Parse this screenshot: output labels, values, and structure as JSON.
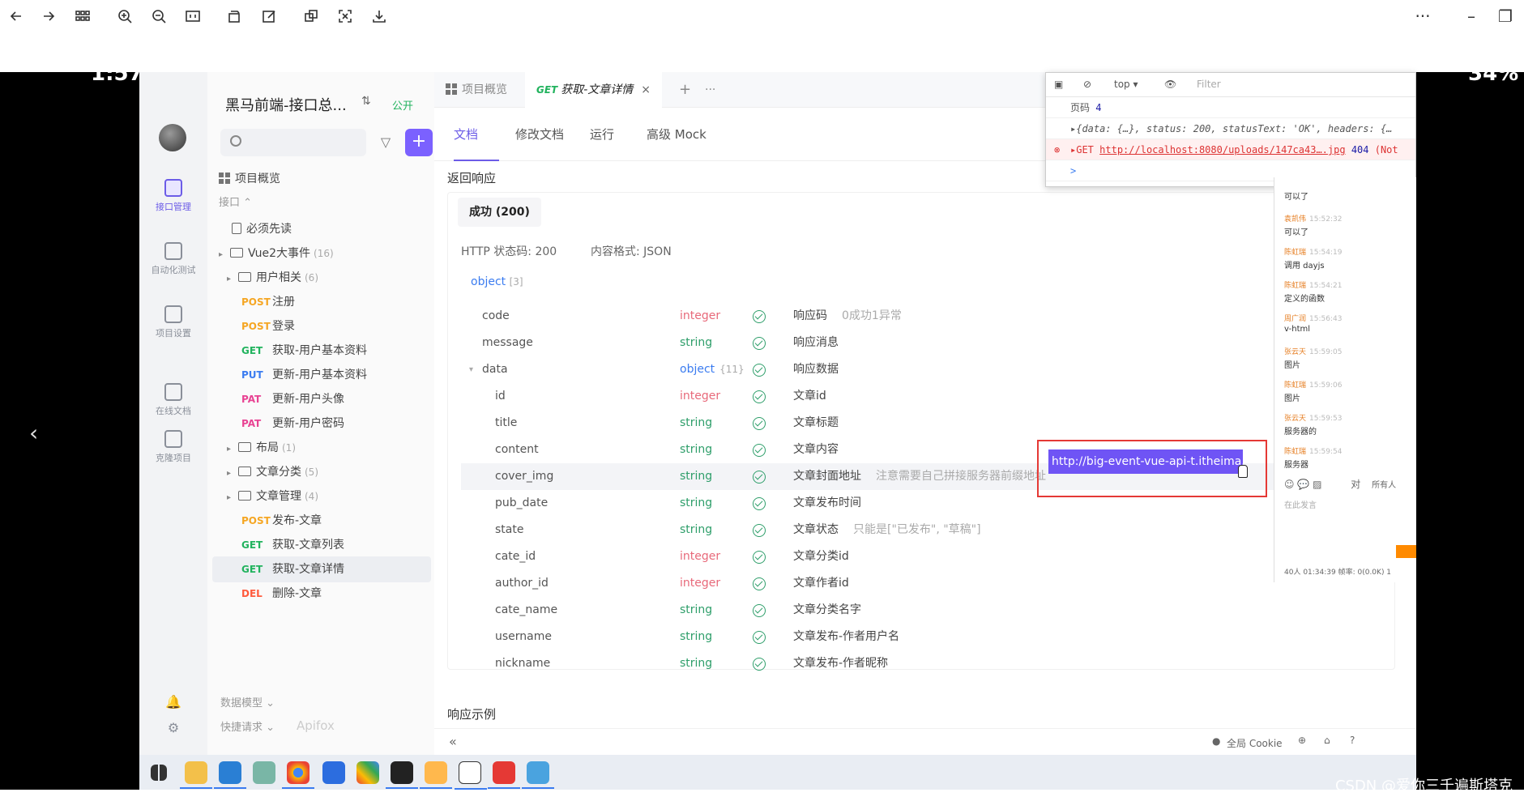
{
  "viewer": {
    "more_label": "···",
    "min_label": "–",
    "restore_label": "❐"
  },
  "overlay": {
    "left_text": "1:57",
    "right_text": "34%"
  },
  "rail": {
    "items": [
      {
        "label": "接口管理",
        "icon": "api-icon"
      },
      {
        "label": "自动化测试",
        "icon": "test-icon"
      },
      {
        "label": "项目设置",
        "icon": "settings-icon"
      },
      {
        "label": "在线文档",
        "icon": "book-icon"
      },
      {
        "label": "克隆项目",
        "icon": "clone-icon"
      }
    ]
  },
  "sidebar": {
    "project_name": "黑马前端-接口总...",
    "project_badge": "公开",
    "filter_icon": "▽",
    "add_label": "+",
    "overview": "项目概览",
    "interfaces": "接口 ⌃",
    "must_read": "必须先读",
    "tree": [
      {
        "type": "folder",
        "label": "Vue2大事件",
        "count": "(16)",
        "indent": 0
      },
      {
        "type": "folder",
        "label": "用户相关",
        "count": "(6)",
        "indent": 1
      },
      {
        "type": "api",
        "method": "POST",
        "label": "注册"
      },
      {
        "type": "api",
        "method": "POST",
        "label": "登录"
      },
      {
        "type": "api",
        "method": "GET",
        "label": "获取-用户基本资料"
      },
      {
        "type": "api",
        "method": "PUT",
        "label": "更新-用户基本资料"
      },
      {
        "type": "api",
        "method": "PAT",
        "label": "更新-用户头像"
      },
      {
        "type": "api",
        "method": "PAT",
        "label": "更新-用户密码"
      },
      {
        "type": "folder",
        "label": "布局",
        "count": "(1)",
        "indent": 1
      },
      {
        "type": "folder",
        "label": "文章分类",
        "count": "(5)",
        "indent": 1
      },
      {
        "type": "folder",
        "label": "文章管理",
        "count": "(4)",
        "indent": 1
      },
      {
        "type": "api",
        "method": "POST",
        "label": "发布-文章"
      },
      {
        "type": "api",
        "method": "GET",
        "label": "获取-文章列表"
      },
      {
        "type": "api",
        "method": "GET",
        "label": "获取-文章详情",
        "selected": true
      },
      {
        "type": "api",
        "method": "DEL",
        "label": "删除-文章"
      }
    ],
    "data_models": "数据模型 ⌄",
    "quick_request": "快捷请求 ⌄",
    "brand": "Apifox"
  },
  "tabs": {
    "overview": "项目概览",
    "active_method": "GET",
    "active_label": "获取-文章详情",
    "close": "×",
    "add": "+",
    "more": "···"
  },
  "subtabs": [
    "文档",
    "修改文档",
    "运行",
    "高级 Mock"
  ],
  "response": {
    "section_title": "返回响应",
    "success_tab": "成功 (200)",
    "http_status": "HTTP 状态码: 200",
    "content_type": "内容格式: JSON",
    "root_label": "object",
    "root_count": "[3]",
    "fields": [
      {
        "name": "code",
        "type": "integer",
        "desc": "响应码",
        "note": "0成功1异常",
        "level": 0
      },
      {
        "name": "message",
        "type": "string",
        "desc": "响应消息",
        "note": "",
        "level": 0
      },
      {
        "name": "data",
        "type": "object",
        "type_count": "{11}",
        "desc": "响应数据",
        "note": "",
        "level": 0
      },
      {
        "name": "id",
        "type": "integer",
        "desc": "文章id",
        "note": "",
        "level": 1
      },
      {
        "name": "title",
        "type": "string",
        "desc": "文章标题",
        "note": "",
        "level": 1
      },
      {
        "name": "content",
        "type": "string",
        "desc": "文章内容",
        "note": "",
        "level": 1
      },
      {
        "name": "cover_img",
        "type": "string",
        "desc": "文章封面地址",
        "note": "注意需要自己拼接服务器前缀地址",
        "level": 1,
        "highlight": true
      },
      {
        "name": "pub_date",
        "type": "string",
        "desc": "文章发布时间",
        "note": "",
        "level": 1
      },
      {
        "name": "state",
        "type": "string",
        "desc": "文章状态",
        "note": "只能是[\"已发布\", \"草稿\"]",
        "level": 1
      },
      {
        "name": "cate_id",
        "type": "integer",
        "desc": "文章分类id",
        "note": "",
        "level": 1
      },
      {
        "name": "author_id",
        "type": "integer",
        "desc": "文章作者id",
        "note": "",
        "level": 1
      },
      {
        "name": "cate_name",
        "type": "string",
        "desc": "文章分类名字",
        "note": "",
        "level": 1
      },
      {
        "name": "username",
        "type": "string",
        "desc": "文章发布-作者用户名",
        "note": "",
        "level": 1
      },
      {
        "name": "nickname",
        "type": "string",
        "desc": "文章发布-作者昵称",
        "note": "",
        "level": 1
      }
    ],
    "highlighted_url": "http://big-event-vue-api-t.itheima.net",
    "example_title": "响应示例",
    "collapse": "«",
    "global_cookie": "全局 Cookie"
  },
  "devtools": {
    "context": "top ▾",
    "filter_placeholder": "Filter",
    "page_label": "页码",
    "page_value": "4",
    "log_line": "▸{data: {…}, status: 200, statusText: 'OK', headers: {…",
    "error_method": "▸GET",
    "error_url": "http://localhost:8080/uploads/147ca43….jpg",
    "error_code": "404",
    "error_tail": "(Not",
    "prompt": ">"
  },
  "chat": {
    "messages": [
      {
        "name": "",
        "time": "",
        "text": "可以了"
      },
      {
        "name": "袁凯伟",
        "time": "15:52:32",
        "text": "可以了"
      },
      {
        "name": "陈虹瑞",
        "time": "15:54:19",
        "text": "调用 dayjs"
      },
      {
        "name": "陈虹瑞",
        "time": "15:54:21",
        "text": "定义的函数"
      },
      {
        "name": "周广润",
        "time": "15:56:43",
        "text": "v-html"
      },
      {
        "name": "张云天",
        "time": "15:59:05",
        "text": "图片"
      },
      {
        "name": "陈虹瑞",
        "time": "15:59:06",
        "text": "图片"
      },
      {
        "name": "张云天",
        "time": "15:59:53",
        "text": "服务器的"
      },
      {
        "name": "陈虹瑞",
        "time": "15:59:54",
        "text": "服务器"
      }
    ],
    "to_label": "对",
    "to_value": "所有人",
    "input_placeholder": "在此发言",
    "footer": "40人  01:34:39  帧率: 0(0.0K) 1"
  },
  "watermark": "CSDN @爱你三千遍斯塔克"
}
